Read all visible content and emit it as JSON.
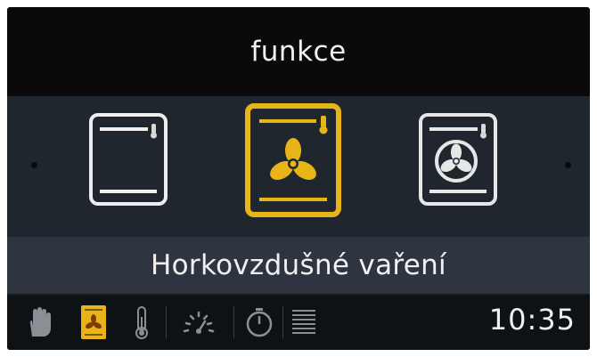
{
  "header": {
    "title": "funkce"
  },
  "modes": [
    {
      "icon": "top-bottom-heat-icon",
      "selected": false
    },
    {
      "icon": "hot-air-fan-icon",
      "selected": true
    },
    {
      "icon": "ring-fan-icon",
      "selected": false
    }
  ],
  "selected_mode": {
    "label": "Horkovzdušné vaření"
  },
  "toolbar": {
    "icons": [
      "hand-icon",
      "function-mode-icon",
      "thermometer-icon",
      "power-gauge-icon",
      "timer-icon",
      "menu-list-icon"
    ],
    "active_icon": "function-mode-icon"
  },
  "status": {
    "time": "10:35"
  },
  "colors": {
    "accent": "#e8b417",
    "background": "#0a0a0a",
    "panel": "#20262e",
    "label_bar": "#2f3540"
  }
}
